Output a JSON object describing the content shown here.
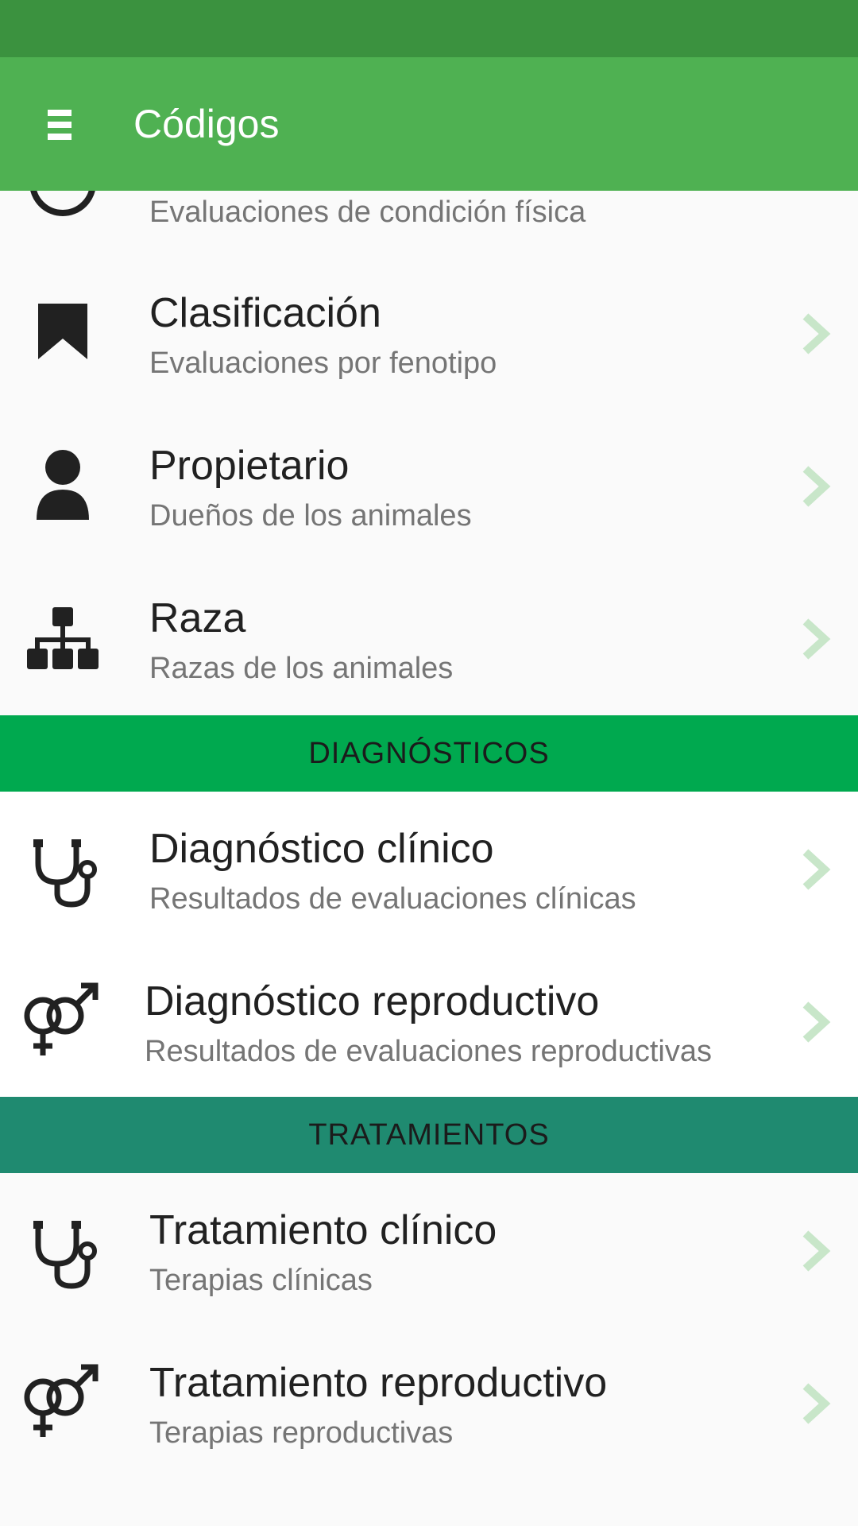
{
  "app": {
    "title": "Códigos"
  },
  "colors": {
    "status_bar": "#3b923f",
    "app_bar": "#4fb152",
    "section_diagnosticos": "#00a94f",
    "section_tratamientos": "#1f8a70",
    "chevron": "#c8e6c9"
  },
  "top_partial": {
    "subtitle": "Evaluaciones de condición física",
    "icon": "target-icon"
  },
  "rows": [
    {
      "title": "Clasificación",
      "subtitle": "Evaluaciones por fenotipo",
      "icon": "bookmark-icon"
    },
    {
      "title": "Propietario",
      "subtitle": "Dueños de los animales",
      "icon": "person-icon"
    },
    {
      "title": "Raza",
      "subtitle": "Razas de los animales",
      "icon": "sitemap-icon"
    }
  ],
  "sections": {
    "diagnosticos": "DIAGNÓSTICOS",
    "tratamientos": "TRATAMIENTOS"
  },
  "diagnosticos": [
    {
      "title": "Diagnóstico clínico",
      "subtitle": "Resultados de evaluaciones clínicas",
      "icon": "stethoscope-icon"
    },
    {
      "title": "Diagnóstico reproductivo",
      "subtitle": "Resultados de evaluaciones reproductivas",
      "icon": "gender-icon"
    }
  ],
  "tratamientos": [
    {
      "title": "Tratamiento clínico",
      "subtitle": "Terapias clínicas",
      "icon": "stethoscope-icon"
    },
    {
      "title": "Tratamiento reproductivo",
      "subtitle": "Terapias reproductivas",
      "icon": "gender-icon"
    }
  ]
}
